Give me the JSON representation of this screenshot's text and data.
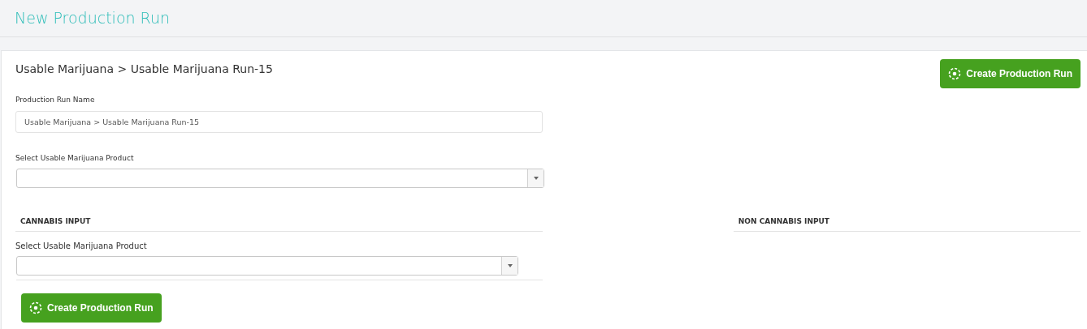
{
  "page_title": "New Production Run",
  "breadcrumb": "Usable Marijuana > Usable Marijuana Run-15",
  "top_button": {
    "label": "Create Production Run"
  },
  "name_field": {
    "label": "Production Run Name",
    "value": "Usable Marijuana > Usable Marijuana Run-15"
  },
  "product_select": {
    "label": "Select Usable Marijuana Product"
  },
  "cannabis_input": {
    "heading": "CANNABIS INPUT",
    "select_label": "Select Usable Marijuana Product"
  },
  "non_cannabis_input": {
    "heading": "NON CANNABIS INPUT"
  },
  "bottom_button": {
    "label": "Create Production Run"
  }
}
